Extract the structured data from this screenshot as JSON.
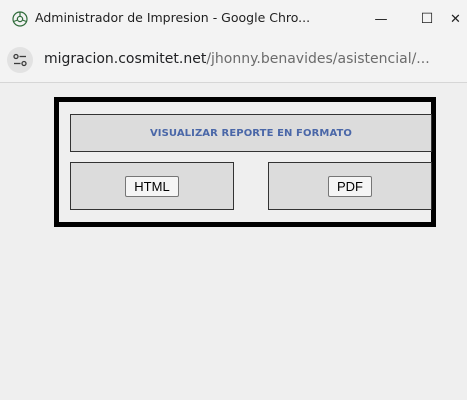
{
  "window": {
    "title": "Administrador de Impresion - Google Chro...",
    "minimize_glyph": "—",
    "maximize_glyph": "☐",
    "close_glyph": "✕"
  },
  "address_bar": {
    "host": "migracion.cosmitet.net",
    "path": "/jhonny.benavides/asistencial/..."
  },
  "report": {
    "header": "VISUALIZAR REPORTE EN FORMATO",
    "html_button": "HTML",
    "pdf_button": "PDF"
  },
  "colors": {
    "header_text": "#4a67a8",
    "cell_background": "#dcdcdc",
    "page_background": "#efefef"
  },
  "icons": {
    "app": "chrome-app-icon",
    "site_info": "site-info-icon"
  }
}
